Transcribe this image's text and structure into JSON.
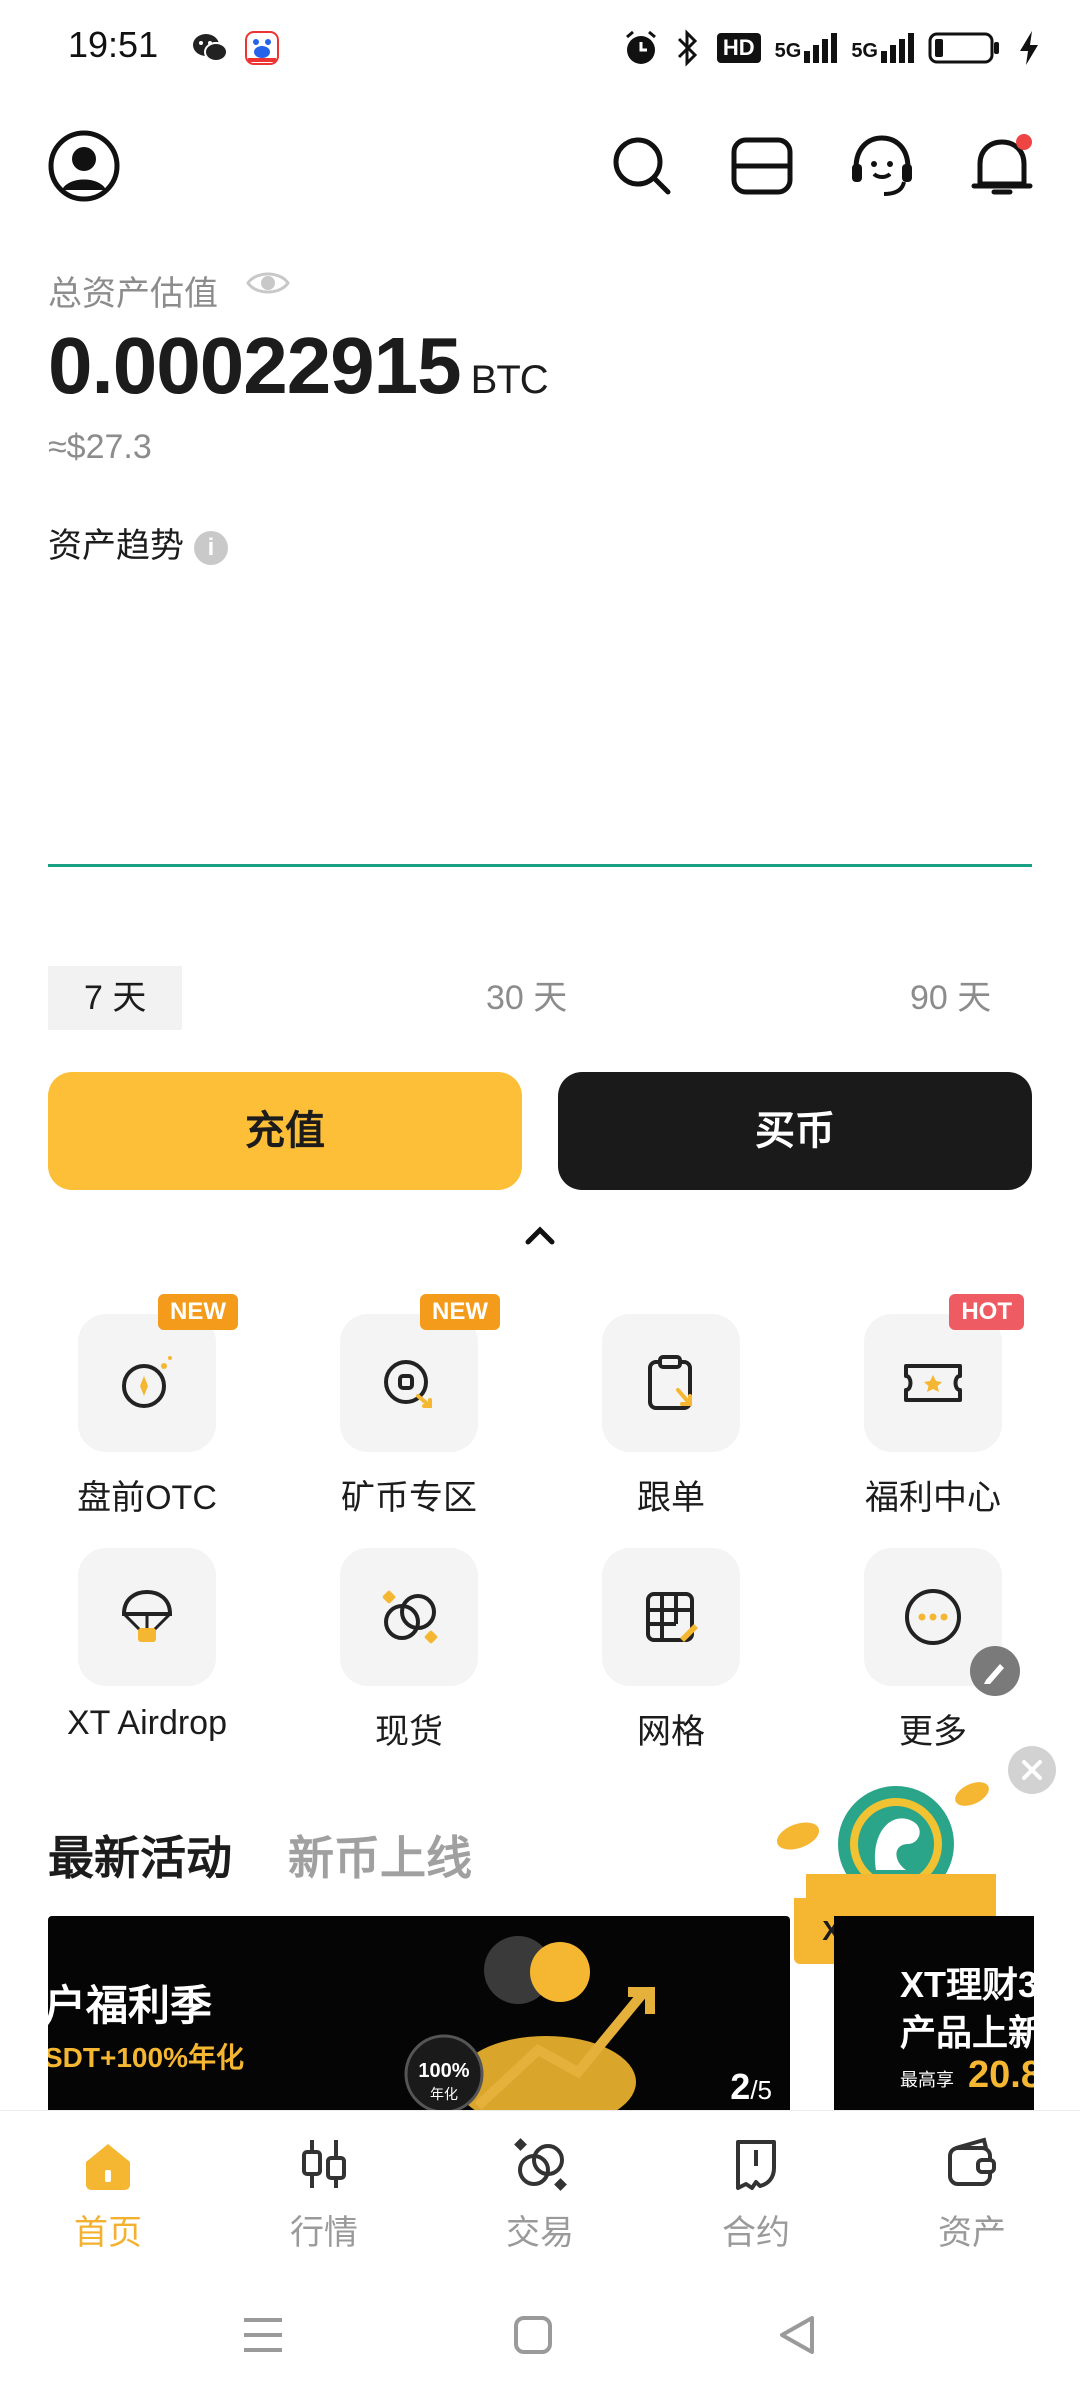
{
  "status_bar": {
    "time": "19:51",
    "hd_label": "HD",
    "signal_1_label": "5G",
    "signal_2_label": "5G"
  },
  "header": {
    "icons": [
      "avatar-icon",
      "search-icon",
      "scan-icon",
      "support-icon",
      "bell-icon"
    ]
  },
  "balance": {
    "label": "总资产估值",
    "amount": "0.00022915",
    "unit": "BTC",
    "fiat": "≈$27.3"
  },
  "trend": {
    "title": "资产趋势",
    "info_glyph": "i",
    "line_color": "#1aa082",
    "ranges": [
      "7 天",
      "30 天",
      "90 天"
    ],
    "active_range": "7 天"
  },
  "actions": {
    "deposit_label": "充值",
    "buy_label": "买币"
  },
  "shortcuts": [
    {
      "label": "盘前OTC",
      "badge": "NEW"
    },
    {
      "label": "矿币专区",
      "badge": "NEW"
    },
    {
      "label": "跟单",
      "badge": ""
    },
    {
      "label": "福利中心",
      "badge": "HOT"
    },
    {
      "label": "XT Airdrop",
      "badge": ""
    },
    {
      "label": "现货",
      "badge": ""
    },
    {
      "label": "网格",
      "badge": ""
    },
    {
      "label": "更多",
      "badge": ""
    }
  ],
  "news_tabs": {
    "active": "最新活动",
    "inactive": "新币上线"
  },
  "floating_promo": {
    "label": "XT Airdrop"
  },
  "banners": {
    "b1_line1": "户福利季",
    "b1_line2": "SDT+100%年化",
    "b1_coin_text": "100%",
    "b1_coin_sub": "年化",
    "b1_page_current": "2",
    "b1_page_total": "/5",
    "b2_line1": "XT理财3",
    "b2_line2": "产品上新",
    "b2_small": "最高享",
    "b2_rate": "20.8"
  },
  "bottom_nav": [
    {
      "label": "首页",
      "active": true
    },
    {
      "label": "行情",
      "active": false
    },
    {
      "label": "交易",
      "active": false
    },
    {
      "label": "合约",
      "active": false
    },
    {
      "label": "资产",
      "active": false
    }
  ],
  "colors": {
    "accent": "#fcbf37",
    "active_nav": "#f4b12f",
    "new_badge": "#f59b1b",
    "hot_badge": "#ef5b62"
  }
}
